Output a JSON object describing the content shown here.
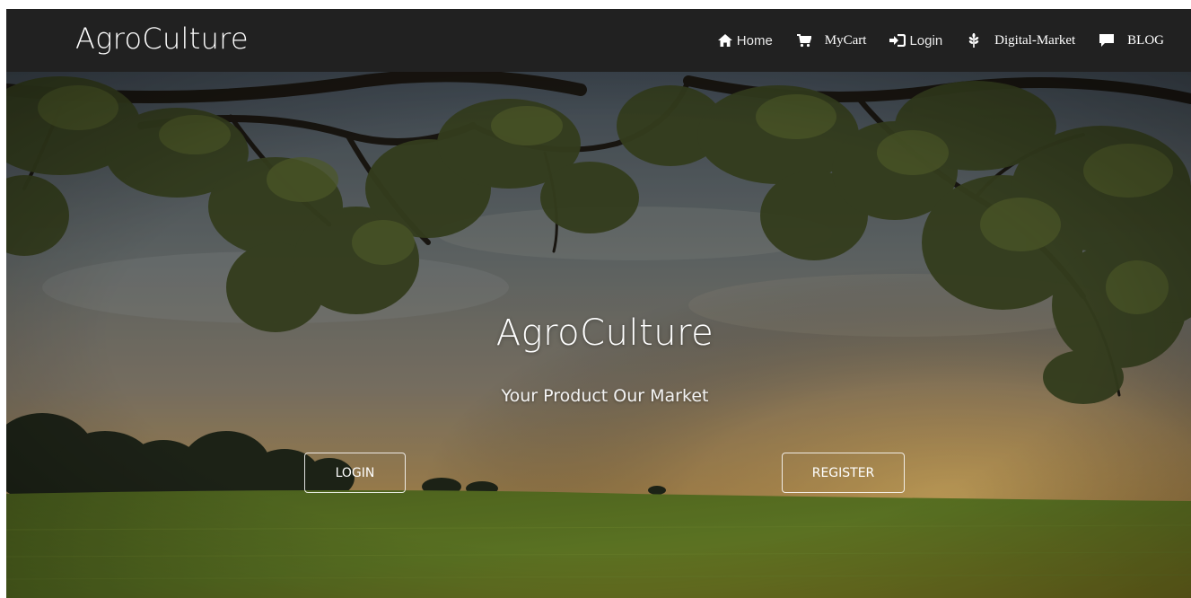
{
  "navbar": {
    "brand": "AgroCulture",
    "links": [
      {
        "label": "Home",
        "icon": "home-icon"
      },
      {
        "label": "MyCart",
        "icon": "cart-icon"
      },
      {
        "label": "Login",
        "icon": "login-icon"
      },
      {
        "label": "Digital-Market",
        "icon": "grain-icon"
      },
      {
        "label": "BLOG",
        "icon": "comment-icon"
      }
    ]
  },
  "hero": {
    "title": "AgroCulture",
    "subtitle": "Your Product Our Market",
    "login_label": "LOGIN",
    "register_label": "REGISTER"
  },
  "colors": {
    "navbar_bg": "#212121",
    "text": "#ffffff",
    "grass": "#6f8a2c",
    "sky": "#8a8f8e"
  }
}
